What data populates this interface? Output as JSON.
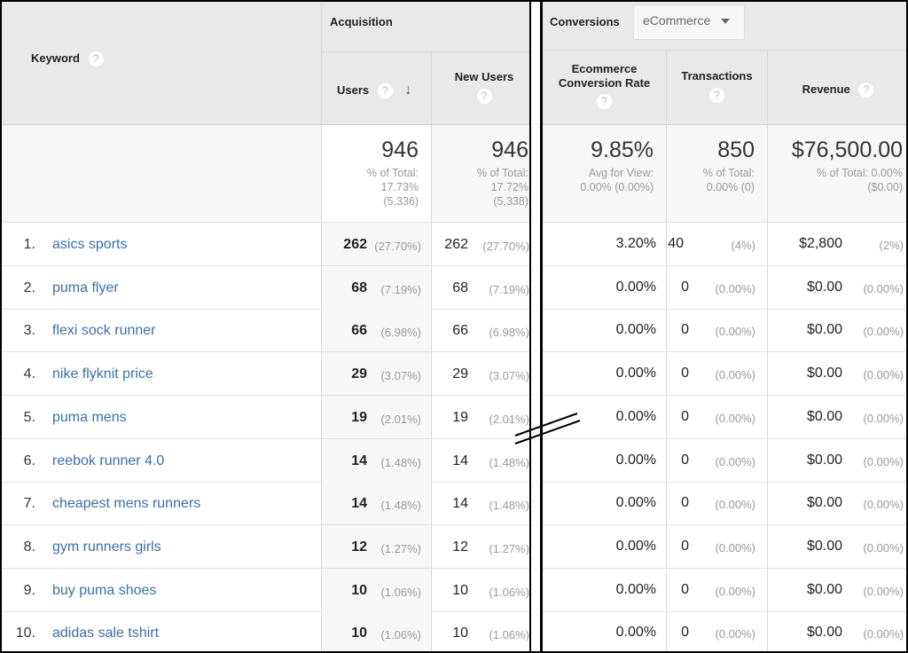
{
  "header": {
    "keyword_label": "Keyword",
    "acquisition_label": "Acquisition",
    "users_label": "Users",
    "new_users_label": "New Users",
    "conversions_label": "Conversions",
    "conversions_dropdown_value": "eCommerce",
    "ecommerce_rate_label_line1": "Ecommerce",
    "ecommerce_rate_label_line2": "Conversion Rate",
    "transactions_label": "Transactions",
    "revenue_label": "Revenue",
    "help_glyph": "?",
    "sort_icon": "arrow-down-icon",
    "sort_glyph": "↓"
  },
  "totals": {
    "users": {
      "value": "946",
      "line1": "% of Total:",
      "line2": "17.73%",
      "line3": "(5,336)"
    },
    "new_users": {
      "value": "946",
      "line1": "% of Total:",
      "line2": "17.72%",
      "line3": "(5,338)"
    },
    "ecommerce_rate": {
      "value": "9.85%",
      "line1": "Avg for View:",
      "line2": "0.00% (0.00%)"
    },
    "transactions": {
      "value": "850",
      "line1": "% of Total:",
      "line2": "0.00% (0)"
    },
    "revenue": {
      "value": "$76,500.00",
      "line1": "% of Total: 0.00%",
      "line2": "($0.00)"
    }
  },
  "rows": [
    {
      "num": "1.",
      "keyword": "asics sports",
      "users": "262",
      "users_pct": "(27.70%)",
      "new_users": "262",
      "new_users_pct": "(27.70%)",
      "rate": "3.20%",
      "transactions": "40",
      "transactions_pct": "(4%)",
      "revenue": "$2,800",
      "revenue_pct": "(2%)"
    },
    {
      "num": "2.",
      "keyword": "puma flyer",
      "users": "68",
      "users_pct": "(7.19%)",
      "new_users": "68",
      "new_users_pct": "(7.19%)",
      "rate": "0.00%",
      "transactions": "0",
      "transactions_pct": "(0.00%)",
      "revenue": "$0.00",
      "revenue_pct": "(0.00%)"
    },
    {
      "num": "3.",
      "keyword": "flexi sock runner",
      "users": "66",
      "users_pct": "(6.98%)",
      "new_users": "66",
      "new_users_pct": "(6.98%)",
      "rate": "0.00%",
      "transactions": "0",
      "transactions_pct": "(0.00%)",
      "revenue": "$0.00",
      "revenue_pct": "(0.00%)"
    },
    {
      "num": "4.",
      "keyword": "nike flyknit price",
      "users": "29",
      "users_pct": "(3.07%)",
      "new_users": "29",
      "new_users_pct": "(3.07%)",
      "rate": "0.00%",
      "transactions": "0",
      "transactions_pct": "(0.00%)",
      "revenue": "$0.00",
      "revenue_pct": "(0.00%)"
    },
    {
      "num": "5.",
      "keyword": "puma mens",
      "users": "19",
      "users_pct": "(2.01%)",
      "new_users": "19",
      "new_users_pct": "(2.01%)",
      "rate": "0.00%",
      "transactions": "0",
      "transactions_pct": "(0.00%)",
      "revenue": "$0.00",
      "revenue_pct": "(0.00%)"
    },
    {
      "num": "6.",
      "keyword": "reebok runner 4.0",
      "users": "14",
      "users_pct": "(1.48%)",
      "new_users": "14",
      "new_users_pct": "(1.48%)",
      "rate": "0.00%",
      "transactions": "0",
      "transactions_pct": "(0.00%)",
      "revenue": "$0.00",
      "revenue_pct": "(0.00%)"
    },
    {
      "num": "7.",
      "keyword": "cheapest mens runners",
      "users": "14",
      "users_pct": "(1.48%)",
      "new_users": "14",
      "new_users_pct": "(1.48%)",
      "rate": "0.00%",
      "transactions": "0",
      "transactions_pct": "(0.00%)",
      "revenue": "$0.00",
      "revenue_pct": "(0.00%)"
    },
    {
      "num": "8.",
      "keyword": "gym runners girls",
      "users": "12",
      "users_pct": "(1.27%)",
      "new_users": "12",
      "new_users_pct": "(1.27%)",
      "rate": "0.00%",
      "transactions": "0",
      "transactions_pct": "(0.00%)",
      "revenue": "$0.00",
      "revenue_pct": "(0.00%)"
    },
    {
      "num": "9.",
      "keyword": "buy puma shoes",
      "users": "10",
      "users_pct": "(1.06%)",
      "new_users": "10",
      "new_users_pct": "(1.06%)",
      "rate": "0.00%",
      "transactions": "0",
      "transactions_pct": "(0.00%)",
      "revenue": "$0.00",
      "revenue_pct": "(0.00%)"
    },
    {
      "num": "10.",
      "keyword": "adidas sale tshirt",
      "users": "10",
      "users_pct": "(1.06%)",
      "new_users": "10",
      "new_users_pct": "(1.06%)",
      "rate": "0.00%",
      "transactions": "0",
      "transactions_pct": "(0.00%)",
      "revenue": "$0.00",
      "revenue_pct": "(0.00%)"
    }
  ]
}
